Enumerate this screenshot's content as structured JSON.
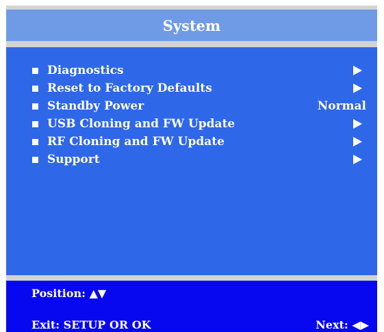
{
  "title": "System",
  "menu": {
    "items": [
      {
        "label": "Diagnostics",
        "value": "",
        "has_arrow": true
      },
      {
        "label": "Reset to Factory Defaults",
        "value": "",
        "has_arrow": true
      },
      {
        "label": "Standby Power",
        "value": "Normal",
        "has_arrow": false
      },
      {
        "label": "USB Cloning and FW Update",
        "value": "",
        "has_arrow": true
      },
      {
        "label": "RF Cloning and FW Update",
        "value": "",
        "has_arrow": true
      },
      {
        "label": "Support",
        "value": "",
        "has_arrow": true
      }
    ]
  },
  "footer": {
    "position_label": "Position: ▲▼",
    "exit_label": "Exit:  SETUP OR OK",
    "next_label": "Next: ◀▶"
  },
  "colors": {
    "title_bar": "#6f9be6",
    "menu_panel": "#2e67e8",
    "footer": "#0808f0",
    "frame": "#d3d3d3"
  },
  "icons": {
    "bullet": "square-bullet-icon",
    "submenu": "right-arrow-icon"
  }
}
